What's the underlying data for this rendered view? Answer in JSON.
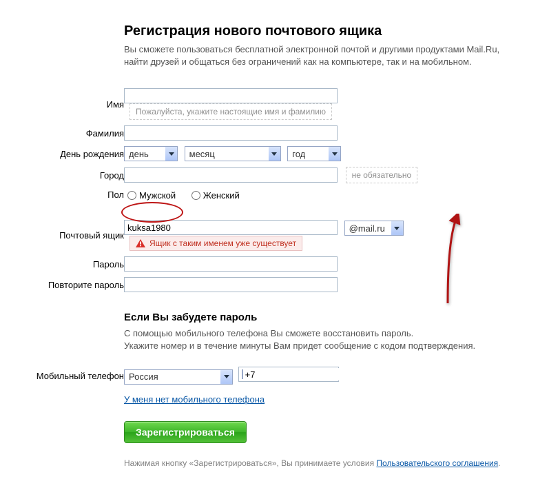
{
  "header": {
    "title": "Регистрация нового почтового ящика",
    "intro_l1": "Вы сможете пользоваться бесплатной электронной почтой и другими продуктами Mail.Ru,",
    "intro_l2": "найти друзей и общаться без ограничений как на компьютере, так и на мобильном."
  },
  "labels": {
    "firstname": "Имя",
    "lastname": "Фамилия",
    "birthday": "День рождения",
    "city": "Город",
    "sex": "Пол",
    "login": "Почтовый ящик",
    "password": "Пароль",
    "password2": "Повторите пароль",
    "phone": "Мобильный телефон"
  },
  "birthday": {
    "day": "день",
    "month": "месяц",
    "year": "год"
  },
  "hints": {
    "name": "Пожалуйста, укажите настоящие имя и фамилию",
    "city": "не обязательно"
  },
  "sex": {
    "male": "Мужской",
    "female": "Женский"
  },
  "login": {
    "value": "kuksa1980",
    "domain": "@mail.ru",
    "error": "Ящик с таким именем уже существует"
  },
  "recovery": {
    "title": "Если Вы забудете пароль",
    "p1": "С помощью мобильного телефона Вы сможете восстановить пароль.",
    "p2": "Укажите номер и в течение минуты Вам придет сообщение с кодом подтверждения."
  },
  "phone": {
    "country": "Россия",
    "prefix": "+7"
  },
  "no_phone_link": "У меня нет мобильного телефона",
  "submit": "Зарегистрироваться",
  "terms": {
    "pre": "Нажимая кнопку «Зарегистрироваться», Вы принимаете условия ",
    "link": "Пользовательского соглашения"
  }
}
